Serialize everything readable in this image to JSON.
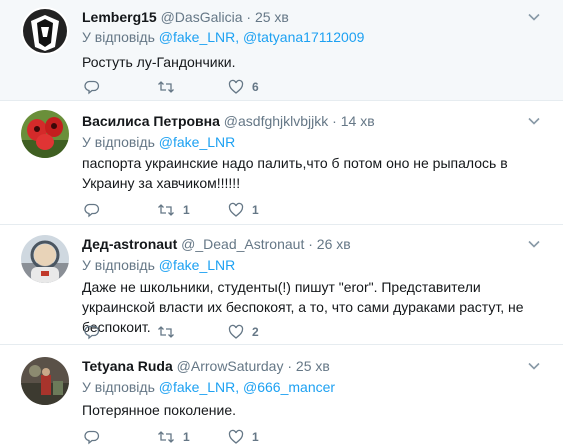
{
  "tweets": [
    {
      "name": "Lemberg15",
      "handle": "@DasGalicia",
      "sep": "·",
      "time": "25 хв",
      "reply_prefix": "У відповідь ",
      "reply_handles": "@fake_LNR, @tatyana17112009",
      "text": "Ростуть лу-Гандончики.",
      "reply_count": "",
      "retweet_count": "",
      "like_count": "6"
    },
    {
      "name": "Василиса Петровна",
      "handle": "@asdfghjklvbjjkk",
      "sep": "·",
      "time": "14 хв",
      "reply_prefix": "У відповідь ",
      "reply_handles": "@fake_LNR",
      "text": "паспорта украинские надо палить,что б потом оно не рыпалось в Украину за хавчиком!!!!!!",
      "reply_count": "",
      "retweet_count": "1",
      "like_count": "1"
    },
    {
      "name": "Дед-astronaut",
      "handle": "@_Dead_Astronaut",
      "sep": "·",
      "time": "26 хв",
      "reply_prefix": "У відповідь ",
      "reply_handles": "@fake_LNR",
      "text": "Даже не школьники, студенты(!) пишут \"eror\". Представители украинской власти их беспокоят, а то, что сами дураками растут, не беспокоит.",
      "reply_count": "",
      "retweet_count": "",
      "like_count": "2"
    },
    {
      "name": "Tetyana Ruda",
      "handle": "@ArrowSaturday",
      "sep": "·",
      "time": "25 хв",
      "reply_prefix": "У відповідь ",
      "reply_handles": "@fake_LNR, @666_mancer",
      "text": "Потерянное поколение.",
      "reply_count": "",
      "retweet_count": "1",
      "like_count": "1"
    }
  ],
  "colors": {
    "link": "#1da1f2",
    "muted": "#657786",
    "text": "#14171a",
    "highlight_bg": "#f5f8fa",
    "divider": "#e6ecf0"
  },
  "icons": {
    "reply": "reply-icon",
    "retweet": "retweet-icon",
    "like": "heart-icon",
    "caret": "chevron-down-icon"
  }
}
